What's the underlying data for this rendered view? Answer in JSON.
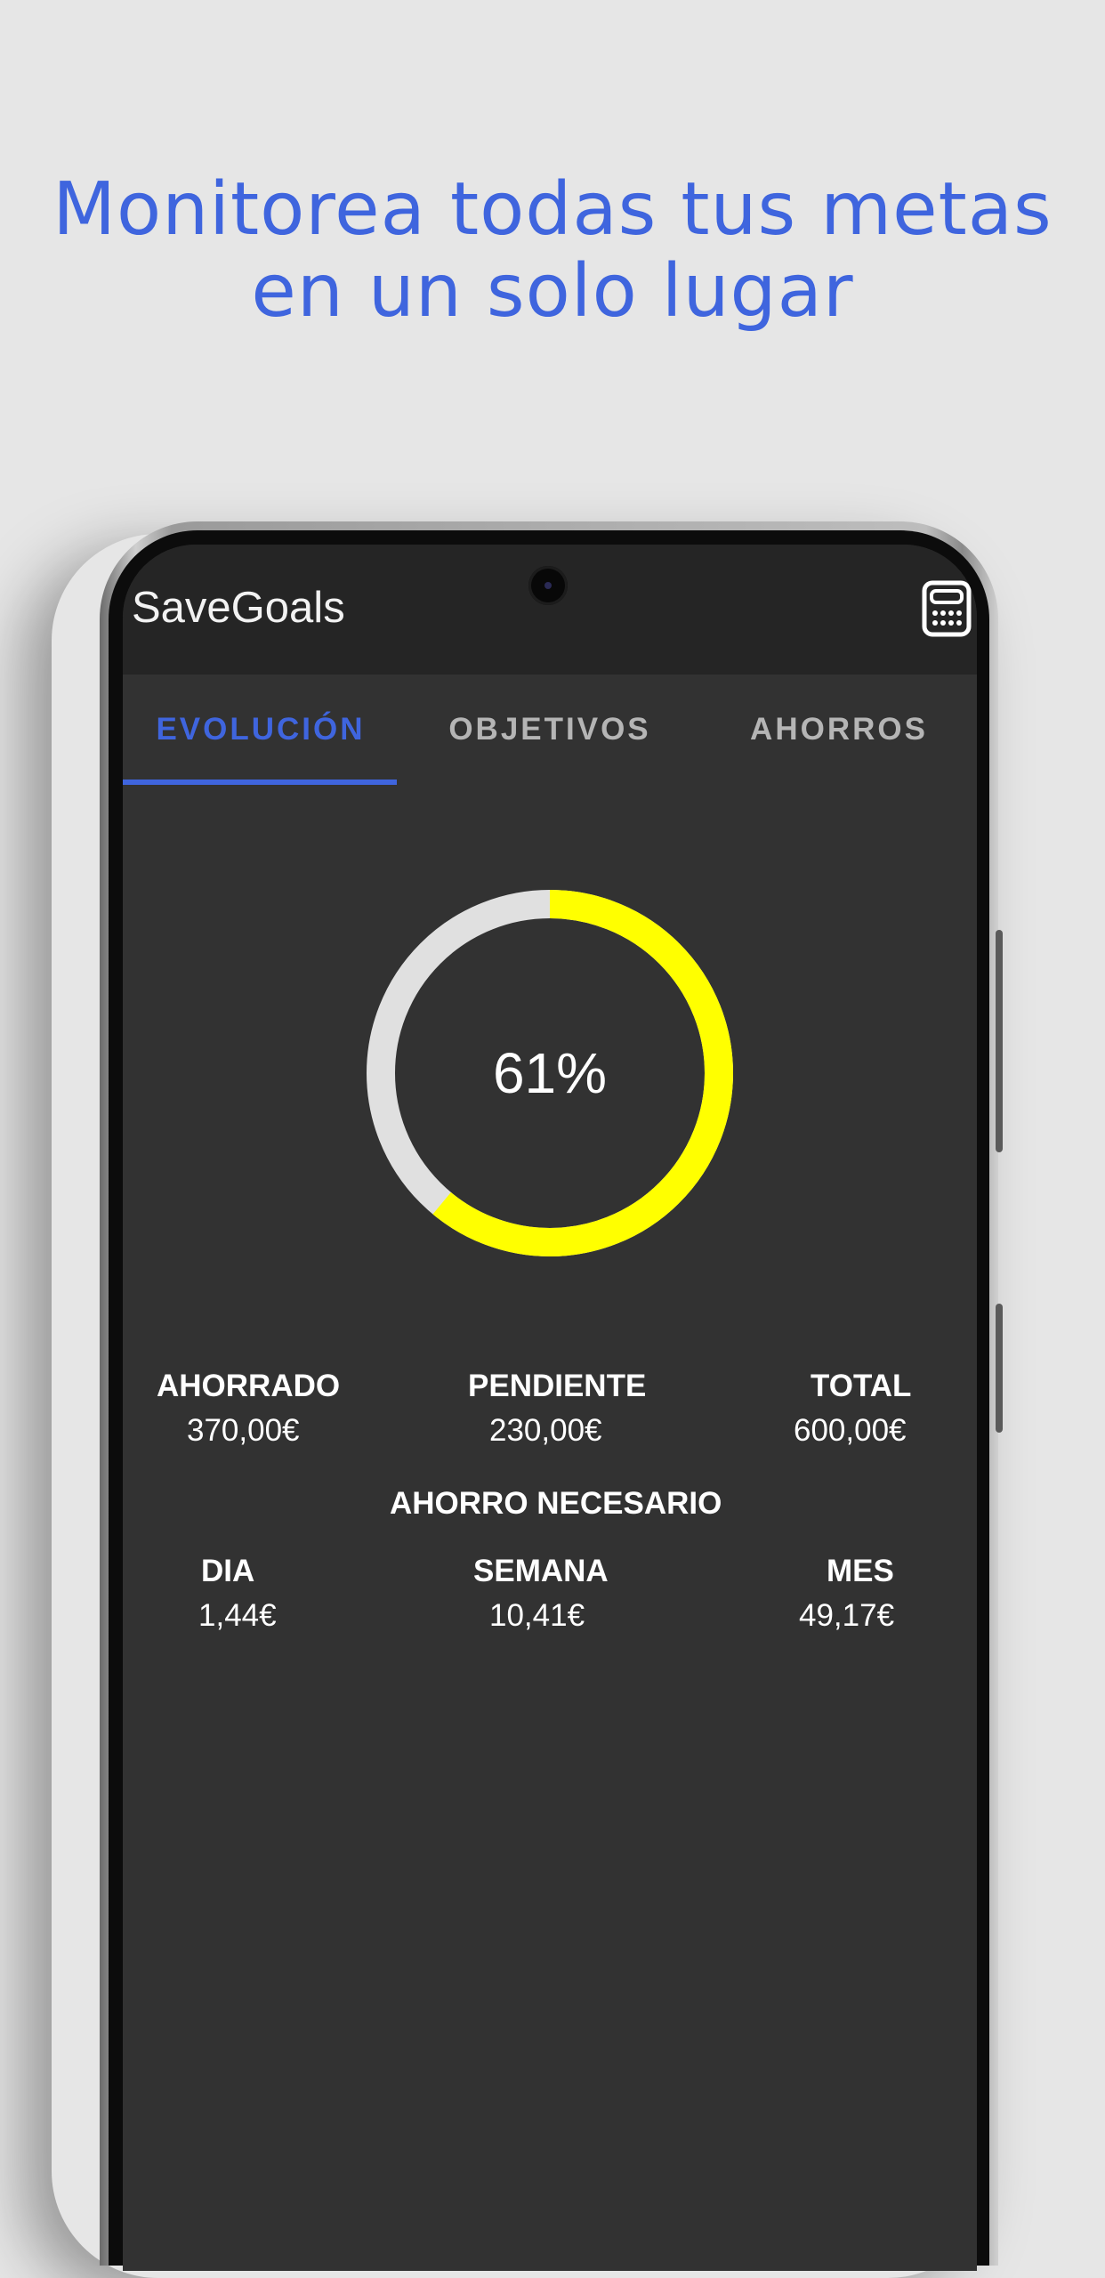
{
  "headline": {
    "line1": "Monitorea todas tus metas",
    "line2": "en un solo lugar"
  },
  "app": {
    "title": "SaveGoals",
    "action_icon": "calculator-icon"
  },
  "tabs": [
    {
      "label": "EVOLUCIÓN",
      "active": true
    },
    {
      "label": "OBJETIVOS",
      "active": false
    },
    {
      "label": "AHORROS",
      "active": false
    }
  ],
  "progress": {
    "percent_label": "61%",
    "value": 0.61,
    "fill_color": "#ffff00",
    "track_color": "#e0e0e0"
  },
  "totals": {
    "saved_label": "AHORRADO",
    "saved_value": "370,00€",
    "pending_label": "PENDIENTE",
    "pending_value": "230,00€",
    "total_label": "TOTAL",
    "total_value": "600,00€"
  },
  "needed": {
    "heading": "AHORRO NECESARIO",
    "day_label": "DIA",
    "day_value": "1,44€",
    "week_label": "SEMANA",
    "week_value": "10,41€",
    "month_label": "MES",
    "month_value": "49,17€"
  },
  "colors": {
    "accent": "#3f65de",
    "background": "#e6e6e6",
    "screen": "#323232",
    "appbar": "#252525"
  }
}
